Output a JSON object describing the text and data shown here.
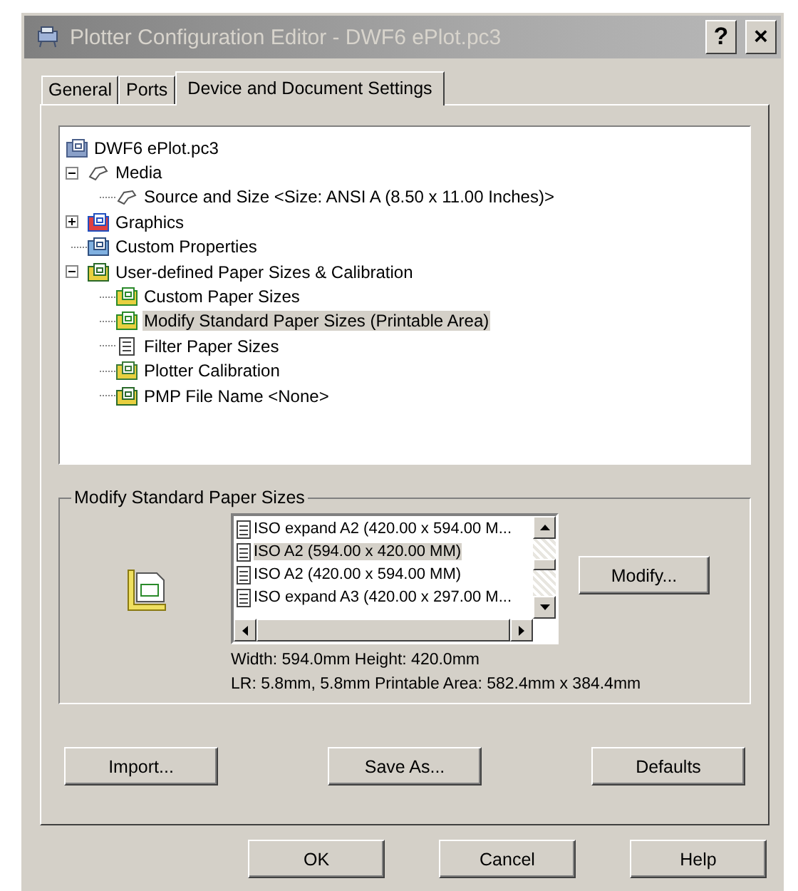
{
  "window": {
    "title": "Plotter Configuration Editor - DWF6 ePlot.pc3",
    "help_button": "?",
    "close_button": "×"
  },
  "tabs": [
    {
      "label": "General",
      "selected": false
    },
    {
      "label": "Ports",
      "selected": false
    },
    {
      "label": "Device and Document Settings",
      "selected": true
    }
  ],
  "tree": [
    {
      "label": "DWF6 ePlot.pc3",
      "kind": "plotter",
      "selected": false,
      "children": [
        {
          "label": "Media",
          "kind": "media",
          "expanded": true,
          "selected": false,
          "children": [
            {
              "label": "Source and Size <Size: ANSI A (8.50 x 11.00 Inches)>",
              "kind": "media",
              "selected": false
            }
          ]
        },
        {
          "label": "Graphics",
          "kind": "graphics",
          "expanded": false,
          "selected": false
        },
        {
          "label": "Custom Properties",
          "kind": "properties",
          "selected": false
        },
        {
          "label": "User-defined Paper Sizes & Calibration",
          "kind": "calibration",
          "expanded": true,
          "selected": false,
          "children": [
            {
              "label": "Custom Paper Sizes",
              "kind": "paper",
              "selected": false
            },
            {
              "label": "Modify Standard Paper Sizes (Printable Area)",
              "kind": "paper",
              "selected": true
            },
            {
              "label": "Filter Paper Sizes",
              "kind": "document",
              "selected": false
            },
            {
              "label": "Plotter Calibration",
              "kind": "plotter_cal",
              "selected": false
            },
            {
              "label": "PMP File Name <None>",
              "kind": "calibration",
              "selected": false
            }
          ]
        }
      ]
    }
  ],
  "group": {
    "title": "Modify Standard Paper Sizes",
    "paper_sizes": [
      {
        "label": "ISO expand A2 (420.00 x 594.00 M...",
        "selected": false
      },
      {
        "label": "ISO A2 (594.00 x 420.00 MM)",
        "selected": true
      },
      {
        "label": "ISO A2 (420.00 x 594.00 MM)",
        "selected": false
      },
      {
        "label": "ISO expand A3 (420.00 x 297.00 M...",
        "selected": false
      }
    ],
    "size_line": "Width: 594.0mm Height: 420.0mm",
    "area_line": "LR: 5.8mm, 5.8mm  Printable Area: 582.4mm x 384.4mm",
    "modify_button": "Modify..."
  },
  "panel_buttons": [
    "Import...",
    "Save As...",
    "Defaults"
  ],
  "dialog_buttons": [
    "OK",
    "Cancel",
    "Help"
  ]
}
